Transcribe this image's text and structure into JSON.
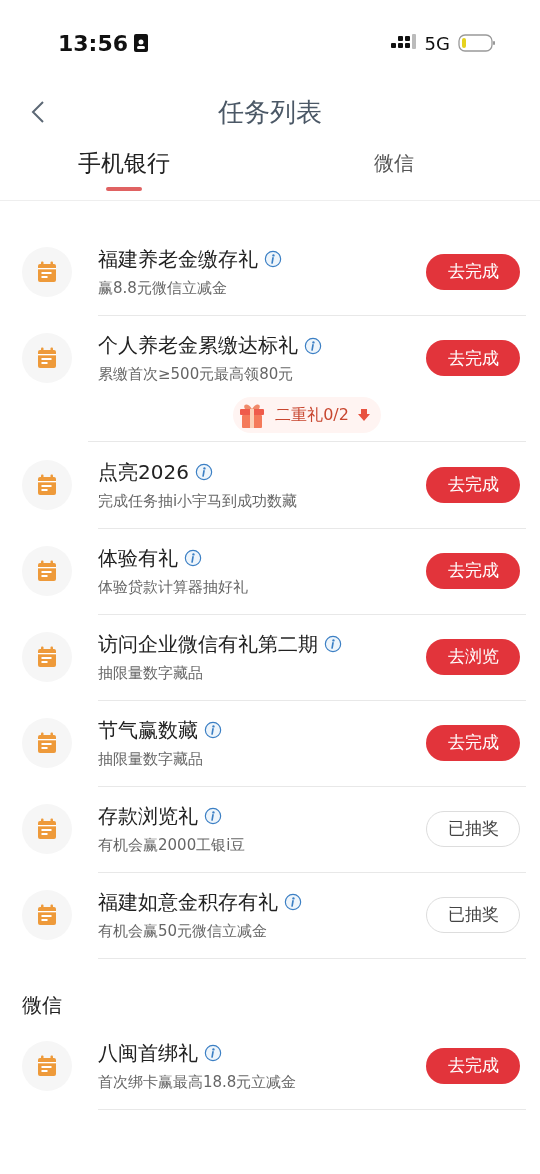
{
  "status_bar": {
    "time": "13:56",
    "network": "5G"
  },
  "header": {
    "title": "任务列表"
  },
  "tabs": [
    {
      "label": "手机银行",
      "selected": true
    },
    {
      "label": "微信",
      "selected": false
    }
  ],
  "sections": [
    {
      "tasks": [
        {
          "title": "福建养老金缴存礼",
          "subtitle": "赢8.8元微信立减金",
          "button": {
            "label": "去完成",
            "kind": "primary"
          }
        },
        {
          "title": "个人养老金累缴达标礼",
          "subtitle": "累缴首次≥500元最高领80元",
          "button": {
            "label": "去完成",
            "kind": "primary"
          },
          "gift": {
            "label": "二重礼0/2"
          }
        },
        {
          "title": "点亮2026",
          "subtitle": "完成任务抽i小宇马到成功数藏",
          "button": {
            "label": "去完成",
            "kind": "primary"
          }
        },
        {
          "title": "体验有礼",
          "subtitle": "体验贷款计算器抽好礼",
          "button": {
            "label": "去完成",
            "kind": "primary"
          }
        },
        {
          "title": "访问企业微信有礼第二期",
          "subtitle": "抽限量数字藏品",
          "button": {
            "label": "去浏览",
            "kind": "primary"
          }
        },
        {
          "title": "节气赢数藏",
          "subtitle": "抽限量数字藏品",
          "button": {
            "label": "去完成",
            "kind": "primary"
          }
        },
        {
          "title": "存款浏览礼",
          "subtitle": "有机会赢2000工银i豆",
          "button": {
            "label": "已抽奖",
            "kind": "done"
          }
        },
        {
          "title": "福建如意金积存有礼",
          "subtitle": "有机会赢50元微信立减金",
          "button": {
            "label": "已抽奖",
            "kind": "done"
          }
        }
      ]
    },
    {
      "heading": "微信",
      "tasks": [
        {
          "title": "八闽首绑礼",
          "subtitle": "首次绑卡赢最高18.8元立减金",
          "button": {
            "label": "去完成",
            "kind": "primary"
          }
        }
      ]
    }
  ]
}
